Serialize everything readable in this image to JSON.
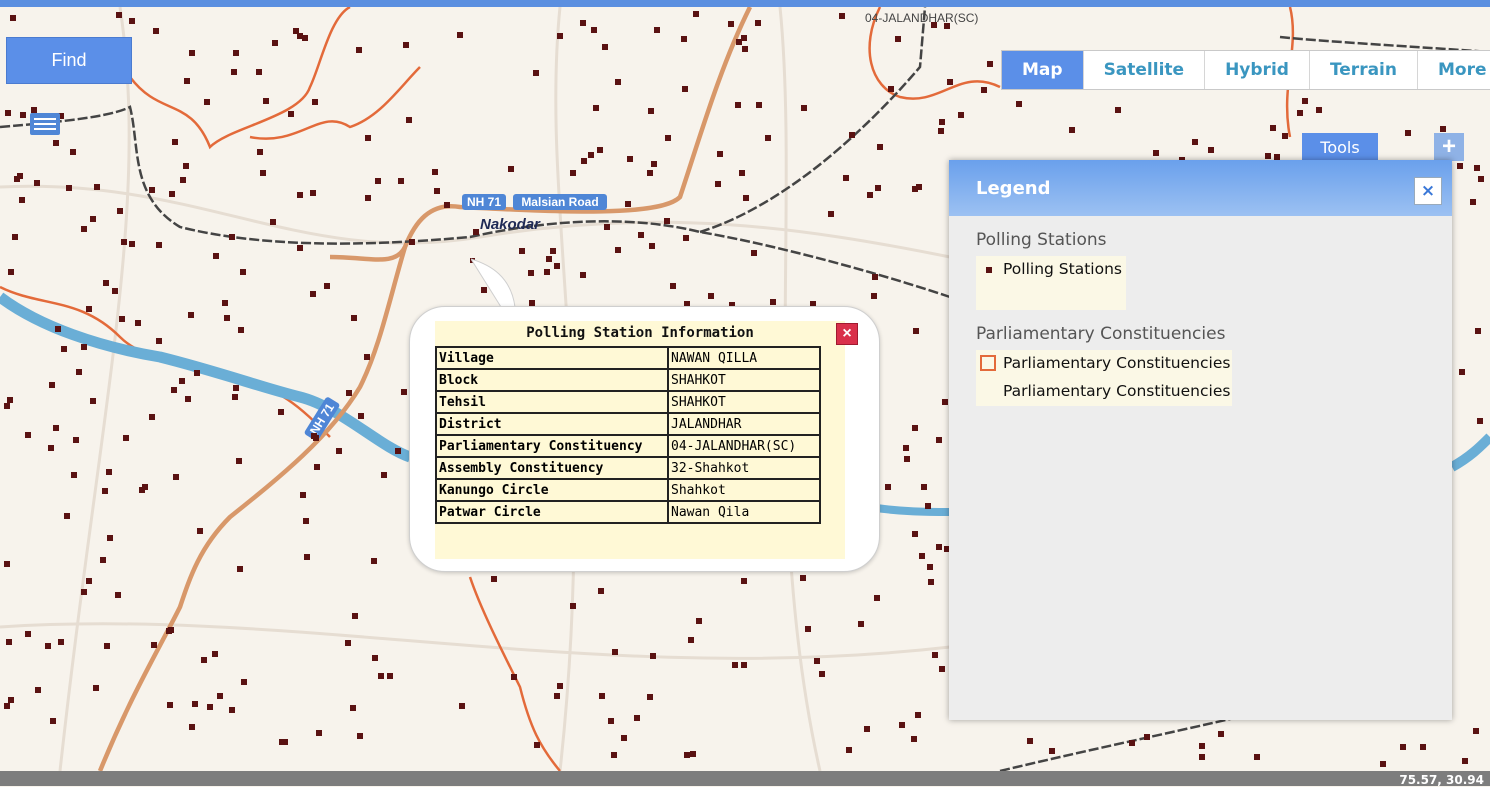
{
  "map": {
    "labels": [
      {
        "id": "top-constituency-label",
        "text": "04-JALANDHAR(SC)"
      },
      {
        "id": "road-label-nh71",
        "text": "NH 71"
      },
      {
        "id": "road-label-malsian",
        "text": "Malsian Road"
      },
      {
        "id": "town-label-nakodar",
        "text": "Nakodar"
      },
      {
        "id": "road-label-nh71-diag",
        "text": "NH 71"
      }
    ]
  },
  "find_button": {
    "label": "Find"
  },
  "map_types": [
    {
      "label": "Map",
      "active": true
    },
    {
      "label": "Satellite",
      "active": false
    },
    {
      "label": "Hybrid",
      "active": false
    },
    {
      "label": "Terrain",
      "active": false
    },
    {
      "label": "More",
      "active": false
    }
  ],
  "tools_button": {
    "label": "Tools"
  },
  "zoom": {
    "in_label": "+"
  },
  "legend": {
    "title": "Legend",
    "close_label": "×",
    "groups": [
      {
        "title": "Polling Stations",
        "items": [
          {
            "label": "Polling Stations",
            "symbol": "square-dot",
            "color": "#5a1212"
          }
        ]
      },
      {
        "title": "Parliamentary Constituencies",
        "items": [
          {
            "label": "Parliamentary Constituencies",
            "symbol": "square-outline",
            "color": "#e36a3a"
          },
          {
            "label": "Parliamentary Constituencies",
            "symbol": "none"
          }
        ]
      }
    ]
  },
  "popup": {
    "title": "Polling Station Information",
    "close_label": "×",
    "rows": [
      {
        "key": "Village",
        "value": "NAWAN QILLA"
      },
      {
        "key": "Block",
        "value": "SHAHKOT"
      },
      {
        "key": "Tehsil",
        "value": "SHAHKOT"
      },
      {
        "key": "District",
        "value": "JALANDHAR"
      },
      {
        "key": "Parliamentary Constituency",
        "value": "04-JALANDHAR(SC)"
      },
      {
        "key": "Assembly Constituency",
        "value": "32-Shahkot"
      },
      {
        "key": "Kanungo Circle",
        "value": "Shahkot"
      },
      {
        "key": "Patwar Circle",
        "value": "Nawan Qila"
      }
    ]
  },
  "coordinates": {
    "text": "75.57, 30.94"
  },
  "colors": {
    "accent": "#5b8fe8",
    "station_dot": "#5a1212",
    "boundary": "#e36a3a",
    "highway": "#d8986a",
    "river": "#6aaed6",
    "railway": "#444444"
  }
}
